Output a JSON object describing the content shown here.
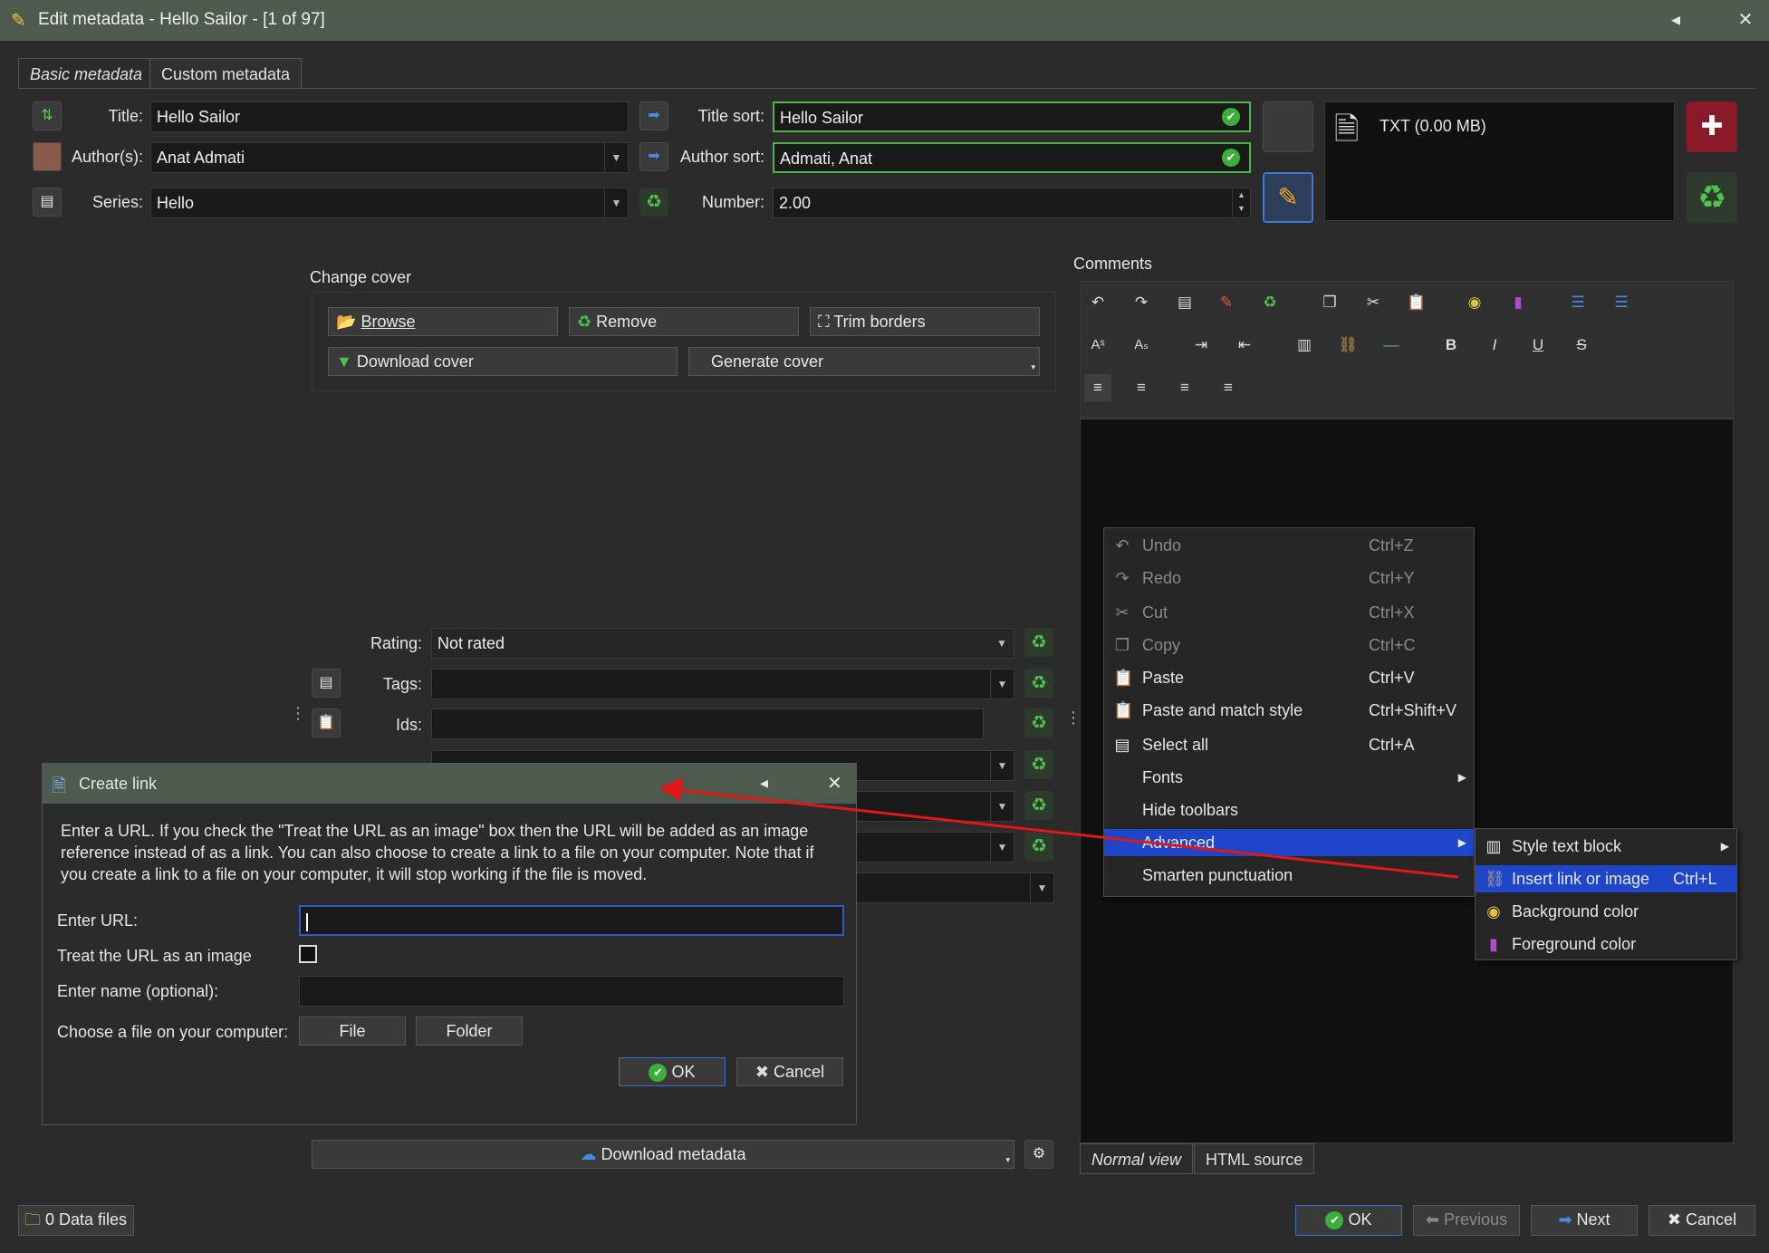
{
  "window": {
    "title": "Edit metadata - Hello Sailor - [1 of 97]",
    "min_icon": "◂",
    "close_icon": "✕"
  },
  "tabs": [
    "Basic metadata",
    "Custom metadata"
  ],
  "fields": {
    "title_label": "Title:",
    "title_value": "Hello Sailor",
    "authors_label": "Author(s):",
    "authors_value": "Anat Admati",
    "series_label": "Series:",
    "series_value": "Hello",
    "title_sort_label": "Title sort:",
    "title_sort_value": "Hello Sailor",
    "author_sort_label": "Author sort:",
    "author_sort_value": "Admati, Anat",
    "number_label": "Number:",
    "number_value": "2.00"
  },
  "formats": {
    "item": "TXT (0.00 MB)"
  },
  "cover": {
    "label": "Change cover",
    "browse": "Browse",
    "remove": "Remove",
    "trim": "Trim borders",
    "download": "Download cover",
    "generate": "Generate cover"
  },
  "meta": {
    "rating_label": "Rating:",
    "rating_value": "Not rated",
    "tags_label": "Tags:",
    "tags_value": "",
    "ids_label": "Ids:",
    "ids_value": ""
  },
  "download_metadata": "Download metadata",
  "comments": {
    "label": "Comments",
    "normal_view": "Normal view",
    "html_source": "HTML source"
  },
  "context_menu": [
    {
      "label": "Undo",
      "shortcut": "Ctrl+Z",
      "icon": "↶",
      "disabled": true
    },
    {
      "label": "Redo",
      "shortcut": "Ctrl+Y",
      "icon": "↷",
      "disabled": true
    },
    {
      "label": "Cut",
      "shortcut": "Ctrl+X",
      "icon": "✂",
      "disabled": true
    },
    {
      "label": "Copy",
      "shortcut": "Ctrl+C",
      "icon": "❐",
      "disabled": true
    },
    {
      "label": "Paste",
      "shortcut": "Ctrl+V",
      "icon": "📋",
      "disabled": false
    },
    {
      "label": "Paste and match style",
      "shortcut": "Ctrl+Shift+V",
      "icon": "📋",
      "disabled": false
    },
    {
      "label": "Select all",
      "shortcut": "Ctrl+A",
      "icon": "▤",
      "disabled": false
    },
    {
      "label": "Fonts",
      "shortcut": "",
      "icon": "",
      "disabled": false
    },
    {
      "label": "Hide toolbars",
      "shortcut": "",
      "icon": "",
      "disabled": false
    },
    {
      "label": "Advanced",
      "shortcut": "",
      "icon": "",
      "disabled": false
    },
    {
      "label": "Smarten punctuation",
      "shortcut": "",
      "icon": "",
      "disabled": false
    }
  ],
  "submenu": [
    {
      "label": "Style text block",
      "shortcut": "",
      "icon": "▥"
    },
    {
      "label": "Insert link or image",
      "shortcut": "Ctrl+L",
      "icon": "⛓"
    },
    {
      "label": "Background color",
      "shortcut": "",
      "icon": "◉"
    },
    {
      "label": "Foreground color",
      "shortcut": "",
      "icon": "▮"
    }
  ],
  "create_link": {
    "title": "Create link",
    "description": "Enter a URL. If you check the \"Treat the URL as an image\" box then the URL will be added as an image reference instead of as a link. You can also choose to create a link to a file on your computer. Note that if you create a link to a file on your computer, it will stop working if the file is moved.",
    "url_label": "Enter URL:",
    "url_value": "",
    "image_label": "Treat the URL as an image",
    "name_label": "Enter name (optional):",
    "name_value": "",
    "file_label": "Choose a file on your computer:",
    "file_btn": "File",
    "folder_btn": "Folder",
    "ok": "OK",
    "cancel": "Cancel"
  },
  "footer": {
    "data_files": "0 Data files",
    "ok": "OK",
    "previous": "Previous",
    "next": "Next",
    "cancel": "Cancel"
  },
  "colors": {
    "accent": "#1f45c8",
    "titlebar": "#4d5a4d",
    "green": "#4bb54b",
    "arrow": "#e01818"
  }
}
